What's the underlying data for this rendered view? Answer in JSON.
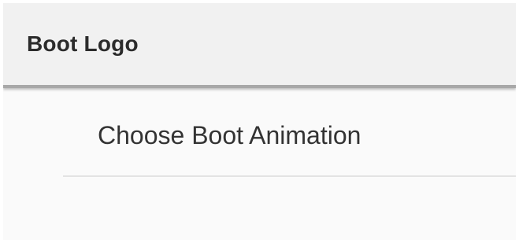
{
  "header": {
    "title": "Boot Logo"
  },
  "list": {
    "items": [
      {
        "label": "Choose Boot Animation"
      }
    ]
  },
  "colors": {
    "header_background": "#f1f1f1",
    "content_background": "#fafafa",
    "text_primary": "#333333",
    "divider": "#e3e3e3"
  }
}
